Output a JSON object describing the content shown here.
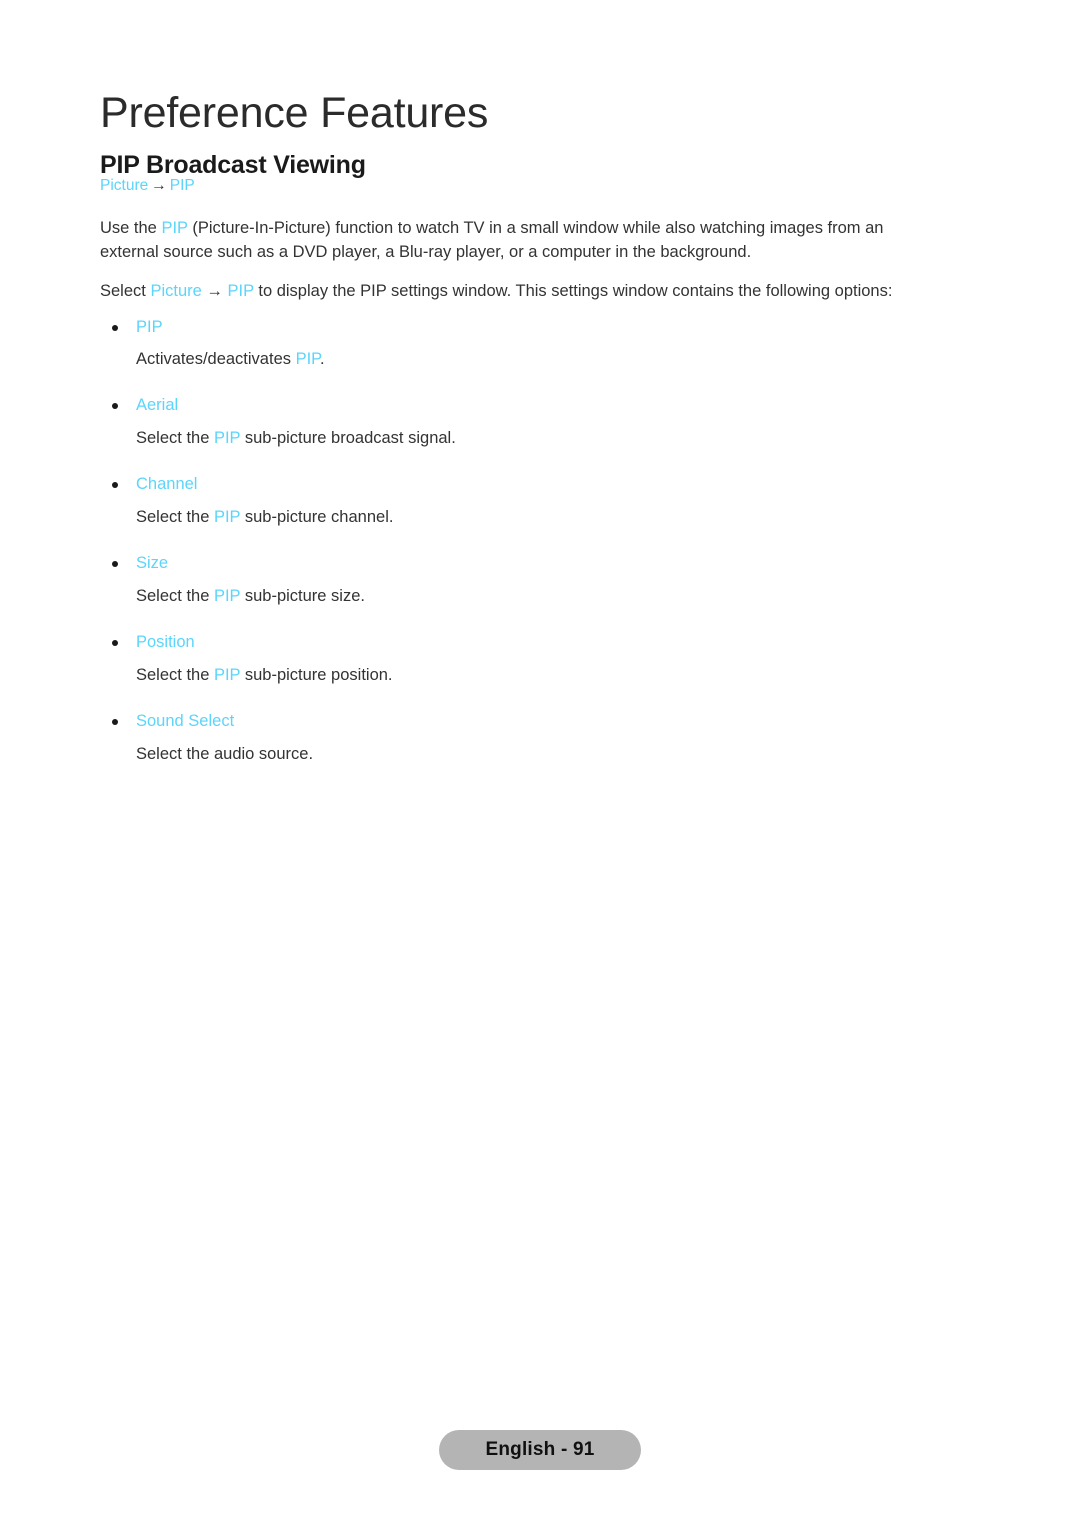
{
  "document": {
    "page_title": "Preference Features",
    "section_title": "PIP Broadcast Viewing"
  },
  "breadcrumb": {
    "root": "Picture",
    "arrow": "→",
    "leaf": "PIP"
  },
  "intro": {
    "paragraph_1": {
      "part_1": "Use the ",
      "highlight_1": "PIP",
      "part_2": " (Picture-In-Picture) function to watch TV in a small window while also watching images from an external source such as a DVD player, a Blu-ray player, or a computer in the background."
    },
    "paragraph_2": {
      "part_1": "Select ",
      "highlight_1": "Picture",
      "arrow": " → ",
      "highlight_2": "PIP",
      "part_2": " to display the PIP settings window. This settings window contains the following options:"
    }
  },
  "options": [
    {
      "label": "PIP",
      "desc_before": "Activates/deactivates ",
      "desc_highlight": "PIP",
      "desc_after": "."
    },
    {
      "label": "Aerial",
      "desc_before": "Select the ",
      "desc_highlight": "PIP",
      "desc_after": " sub-picture broadcast signal."
    },
    {
      "label": "Channel",
      "desc_before": "Select the ",
      "desc_highlight": "PIP",
      "desc_after": " sub-picture channel."
    },
    {
      "label": "Size",
      "desc_before": "Select the ",
      "desc_highlight": "PIP",
      "desc_after": " sub-picture size."
    },
    {
      "label": "Position",
      "desc_before": "Select the ",
      "desc_highlight": "PIP",
      "desc_after": " sub-picture position."
    },
    {
      "label": "Sound Select",
      "desc_before": "Select the audio source.",
      "desc_highlight": "",
      "desc_after": ""
    }
  ],
  "footer": {
    "page_label": "English - 91"
  },
  "colors": {
    "accent": "#5bd5fb",
    "body_text": "#333333",
    "title_text": "#2b2b2b",
    "badge_background": "#b4b4b4",
    "badge_text": "#101010",
    "page_background": "#ffffff"
  }
}
